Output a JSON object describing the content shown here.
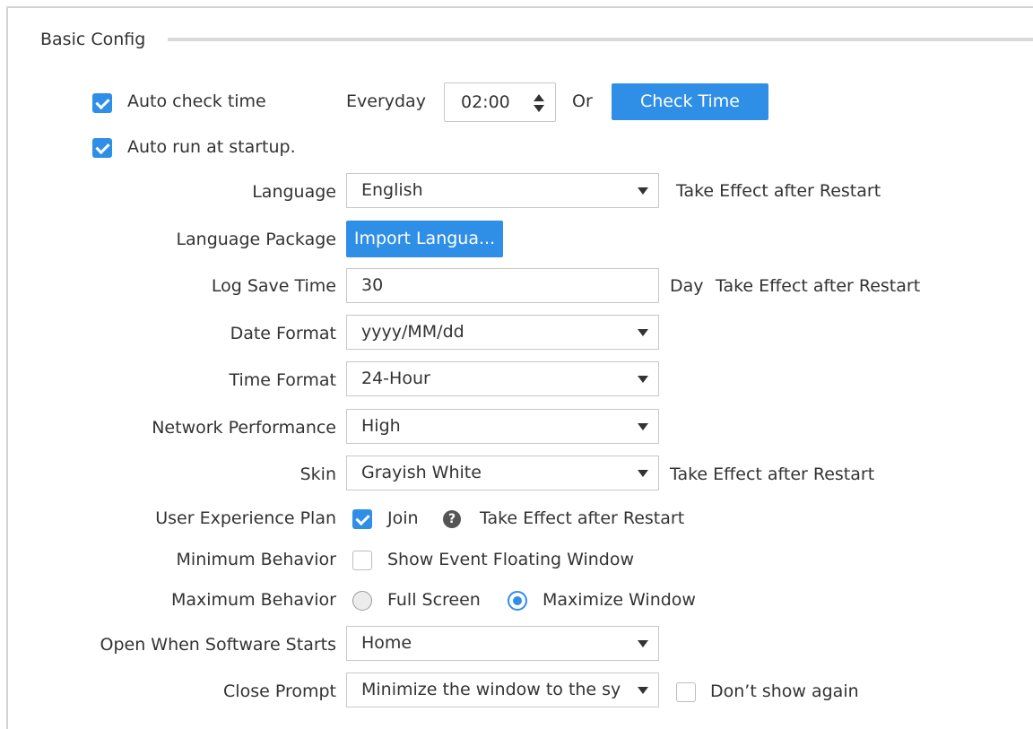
{
  "section": {
    "title": "Basic Config"
  },
  "auto_check": {
    "label": "Auto check time",
    "checked": true,
    "frequency": "Everyday",
    "time": "02:00",
    "or": "Or",
    "button": "Check Time"
  },
  "auto_run": {
    "label": "Auto run at startup.",
    "checked": true
  },
  "language": {
    "label": "Language",
    "value": "English",
    "note": "Take Effect after Restart"
  },
  "language_package": {
    "label": "Language Package",
    "button": "Import Langua..."
  },
  "log_save_time": {
    "label": "Log Save Time",
    "value": "30",
    "unit": "Day",
    "note": "Take Effect after Restart"
  },
  "date_format": {
    "label": "Date Format",
    "value": "yyyy/MM/dd"
  },
  "time_format": {
    "label": "Time Format",
    "value": "24-Hour"
  },
  "network_performance": {
    "label": "Network Performance",
    "value": "High"
  },
  "skin": {
    "label": "Skin",
    "value": "Grayish White",
    "note": "Take Effect after Restart"
  },
  "user_experience": {
    "label": "User Experience Plan",
    "option": "Join",
    "checked": true,
    "help": "?",
    "note": "Take Effect after Restart"
  },
  "minimum_behavior": {
    "label": "Minimum Behavior",
    "option": "Show Event Floating Window",
    "checked": false
  },
  "maximum_behavior": {
    "label": "Maximum Behavior",
    "options": [
      "Full Screen",
      "Maximize Window"
    ],
    "selected": "Maximize Window"
  },
  "open_when_starts": {
    "label": "Open When Software Starts",
    "value": "Home"
  },
  "close_prompt": {
    "label": "Close Prompt",
    "value": "Minimize the window to the sy",
    "dont_show": "Don’t show again",
    "dont_show_checked": false
  },
  "colors": {
    "accent": "#2f8fe6",
    "text": "#333333",
    "border": "#c8c8c8"
  }
}
